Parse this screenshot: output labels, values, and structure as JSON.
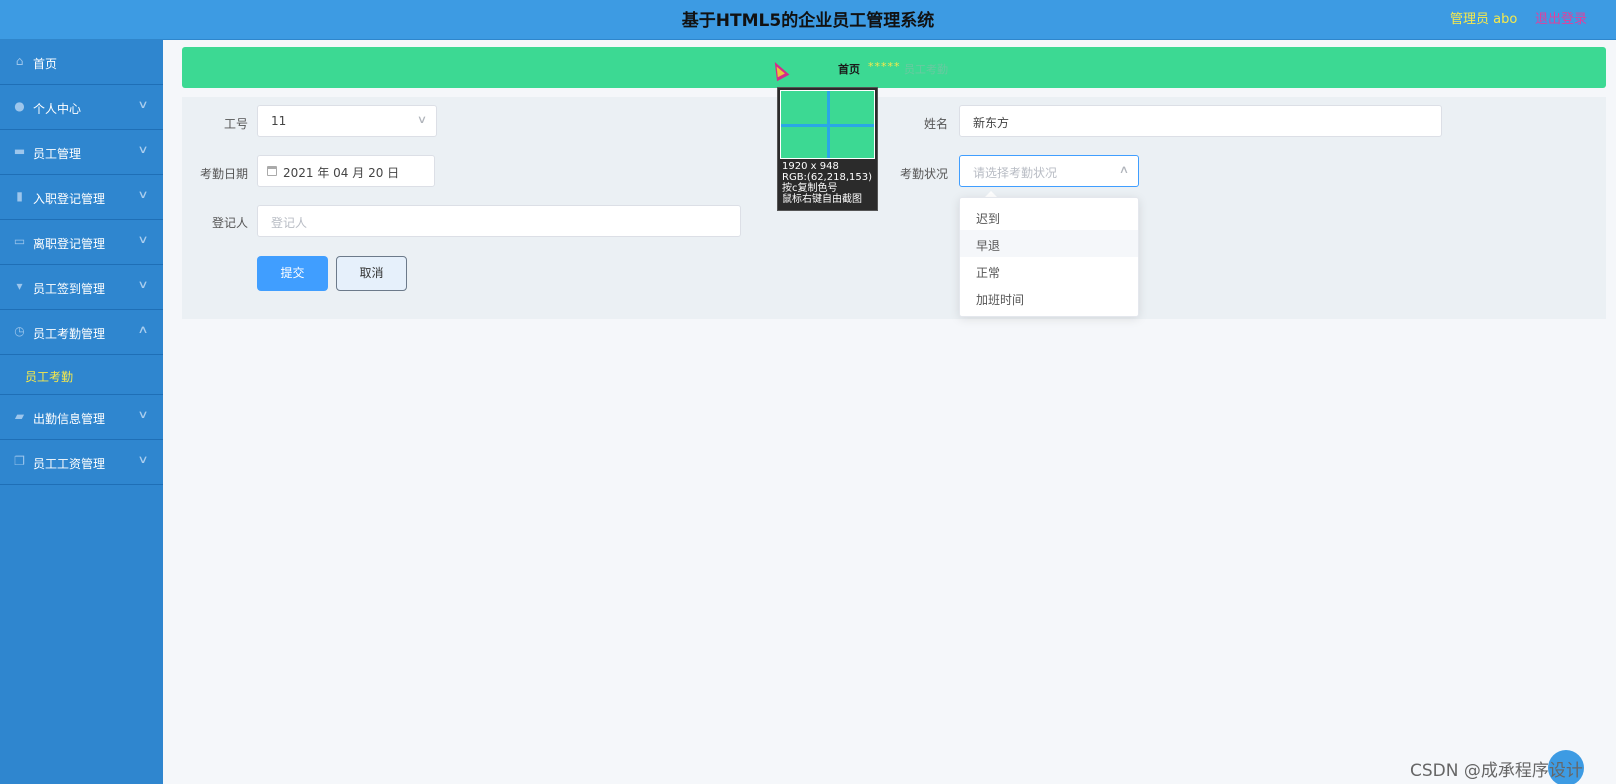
{
  "header": {
    "title": "基于HTML5的企业员工管理系统",
    "user": "管理员 abo",
    "logout": "退出登录"
  },
  "sidebar": {
    "items": [
      {
        "label": "首页",
        "icon": "home-icon"
      },
      {
        "label": "个人中心",
        "icon": "user-icon"
      },
      {
        "label": "员工管理",
        "icon": "monitor-icon"
      },
      {
        "label": "入职登记管理",
        "icon": "chart-icon"
      },
      {
        "label": "离职登记管理",
        "icon": "briefcase-icon"
      },
      {
        "label": "员工签到管理",
        "icon": "pin-icon"
      },
      {
        "label": "员工考勤管理",
        "icon": "clock-icon",
        "expanded": true
      },
      {
        "label": "出勤信息管理",
        "icon": "thumb-icon"
      },
      {
        "label": "员工工资管理",
        "icon": "copy-icon"
      }
    ],
    "subitem": "员工考勤"
  },
  "breadcrumb": {
    "home": "首页",
    "sep": "*****",
    "current": "员工考勤"
  },
  "form": {
    "emp_no_label": "工号",
    "emp_no_value": "11",
    "name_label": "姓名",
    "name_value": "新东方",
    "date_label": "考勤日期",
    "date_value": "2021 年 04 月 20 日",
    "status_label": "考勤状况",
    "status_placeholder": "请选择考勤状况",
    "recorder_label": "登记人",
    "recorder_placeholder": "登记人",
    "submit": "提交",
    "cancel": "取消"
  },
  "dropdown": {
    "options": [
      "迟到",
      "早退",
      "正常",
      "加班时间"
    ],
    "hovered": "早退"
  },
  "magnifier": {
    "size": "1920 x 948",
    "rgb": "RGB:(62,218,153)",
    "hint1": "按c复制色号",
    "hint2": "鼠标右键自由截图"
  },
  "colors": {
    "header": "#3d9be3",
    "sidebar": "#2f86cf",
    "crumb": "#3cd993",
    "primary": "#409eff",
    "active": "#f6e94b"
  },
  "watermark": "CSDN @成承程序设计"
}
